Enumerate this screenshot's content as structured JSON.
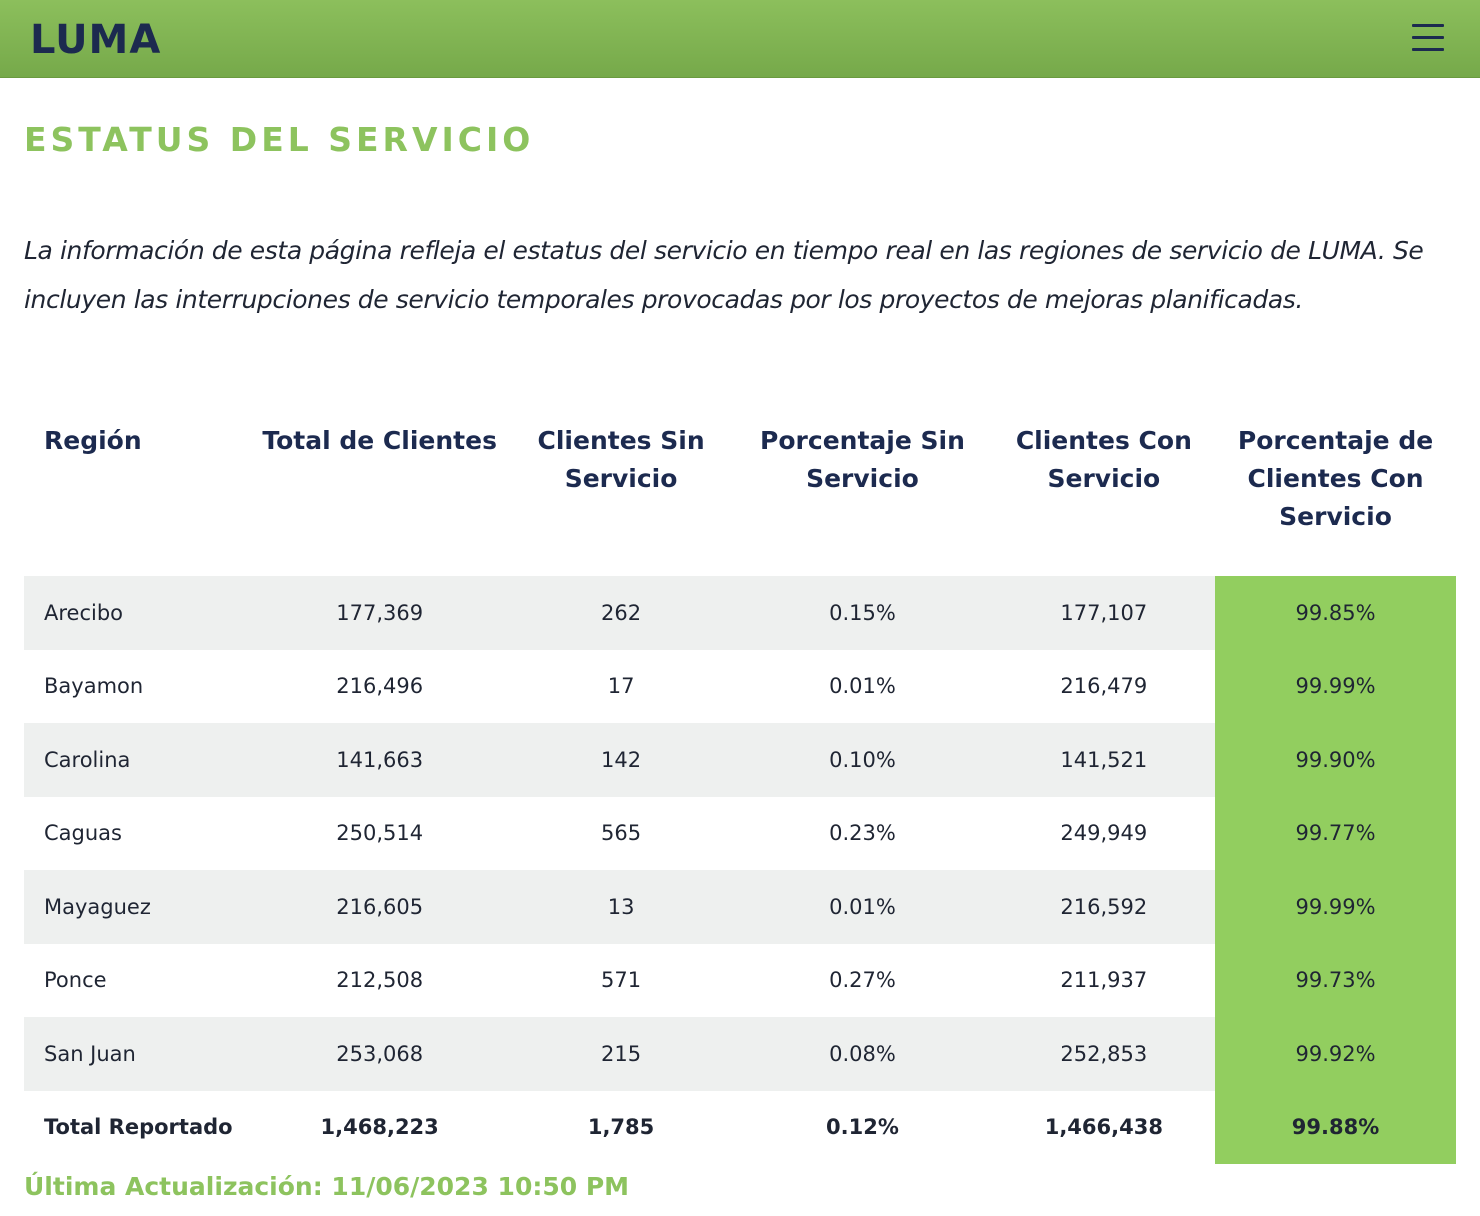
{
  "header": {
    "logo_text": "LUMA",
    "menu_icon": "hamburger-menu-icon"
  },
  "page": {
    "title": "ESTATUS DEL SERVICIO",
    "intro": "La información de esta página refleja el estatus del servicio en tiempo real en las regiones de servicio de LUMA. Se incluyen las interrupciones de servicio temporales provocadas por los proyectos de mejoras planificadas."
  },
  "table": {
    "columns": [
      "Región",
      "Total de Clientes",
      "Clientes Sin Servicio",
      "Porcentaje Sin Servicio",
      "Clientes Con Servicio",
      "Porcentaje de Clientes Con Servicio"
    ],
    "rows": [
      [
        "Arecibo",
        "177,369",
        "262",
        "0.15%",
        "177,107",
        "99.85%"
      ],
      [
        "Bayamon",
        "216,496",
        "17",
        "0.01%",
        "216,479",
        "99.99%"
      ],
      [
        "Carolina",
        "141,663",
        "142",
        "0.10%",
        "141,521",
        "99.90%"
      ],
      [
        "Caguas",
        "250,514",
        "565",
        "0.23%",
        "249,949",
        "99.77%"
      ],
      [
        "Mayaguez",
        "216,605",
        "13",
        "0.01%",
        "216,592",
        "99.99%"
      ],
      [
        "Ponce",
        "212,508",
        "571",
        "0.27%",
        "211,937",
        "99.73%"
      ],
      [
        "San Juan",
        "253,068",
        "215",
        "0.08%",
        "252,853",
        "99.92%"
      ]
    ],
    "total": [
      "Total Reportado",
      "1,468,223",
      "1,785",
      "0.12%",
      "1,466,438",
      "99.88%"
    ]
  },
  "footer": {
    "last_update": "Última Actualización: 11/06/2023 10:50 PM"
  },
  "colors": {
    "header_green": "#7fb350",
    "title_green": "#8dc35e",
    "highlight_green": "#92ce5f",
    "navy": "#1c2a4f",
    "row_shade": "#eef0ef"
  }
}
